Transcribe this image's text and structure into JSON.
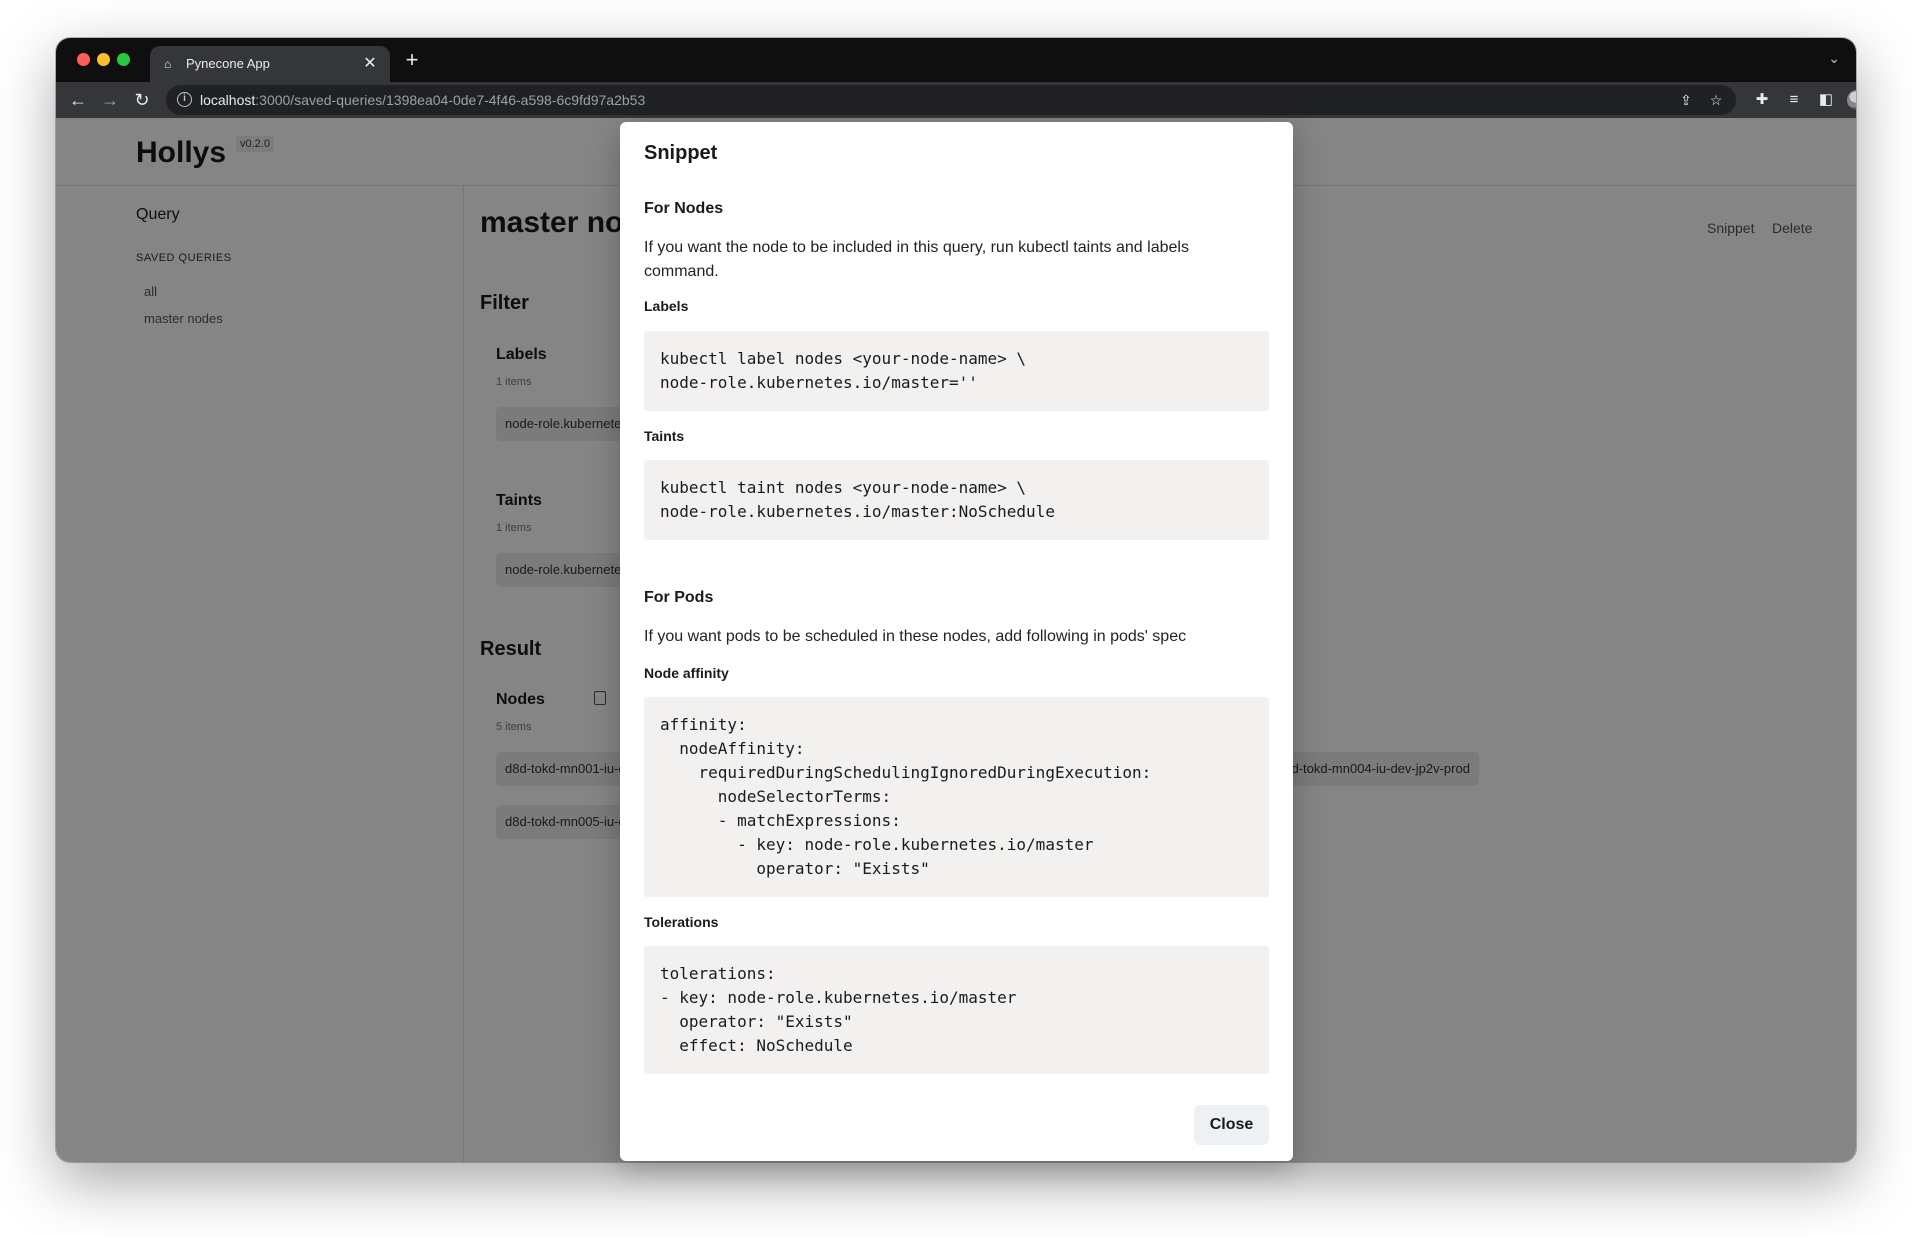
{
  "browser": {
    "tab_title": "Pynecone App",
    "url_host": "localhost",
    "url_rest": ":3000/saved-queries/1398ea04-0de7-4f46-a598-6c9fd97a2b53",
    "new_tab": "+",
    "tab_close": "✕"
  },
  "app": {
    "brand": "Hollys",
    "version": "v0.2.0"
  },
  "sidebar": {
    "query": "Query",
    "section": "SAVED QUERIES",
    "items": [
      {
        "label": "all"
      },
      {
        "label": "master nodes"
      }
    ]
  },
  "main": {
    "title": "master nodes",
    "actions": {
      "snippet": "Snippet",
      "delete": "Delete"
    },
    "filter": {
      "heading": "Filter",
      "labels": {
        "title": "Labels",
        "count": "1 items",
        "chip": "node-role.kubernetes.io/master"
      },
      "taints": {
        "title": "Taints",
        "count": "1 items",
        "chip": "node-role.kubernetes.io/master"
      }
    },
    "result": {
      "heading": "Result",
      "nodes_title": "Nodes",
      "nodes_count": "5 items",
      "chips": [
        "d8d-tokd-mn001-iu-dev-jp2v-prod",
        "d8d-tokd-mn004-iu-dev-jp2v-prod",
        "d8d-tokd-mn005-iu-dev-jp2v-prod"
      ]
    }
  },
  "modal": {
    "title": "Snippet",
    "nodes": {
      "heading": "For Nodes",
      "description": "If you want the node to be included in this query, run kubectl taints and labels command.",
      "labels_title": "Labels",
      "labels_code": "kubectl label nodes <your-node-name> \\\nnode-role.kubernetes.io/master=''",
      "taints_title": "Taints",
      "taints_code": "kubectl taint nodes <your-node-name> \\\nnode-role.kubernetes.io/master:NoSchedule"
    },
    "pods": {
      "heading": "For Pods",
      "description": "If you want pods to be scheduled in these nodes, add following in pods' spec",
      "affinity_title": "Node affinity",
      "affinity_code": "affinity:\n  nodeAffinity:\n    requiredDuringSchedulingIgnoredDuringExecution:\n      nodeSelectorTerms:\n      - matchExpressions:\n        - key: node-role.kubernetes.io/master\n          operator: \"Exists\"",
      "tolerations_title": "Tolerations",
      "tolerations_code": "tolerations:\n- key: node-role.kubernetes.io/master\n  operator: \"Exists\"\n  effect: NoSchedule"
    },
    "close_label": "Close"
  }
}
